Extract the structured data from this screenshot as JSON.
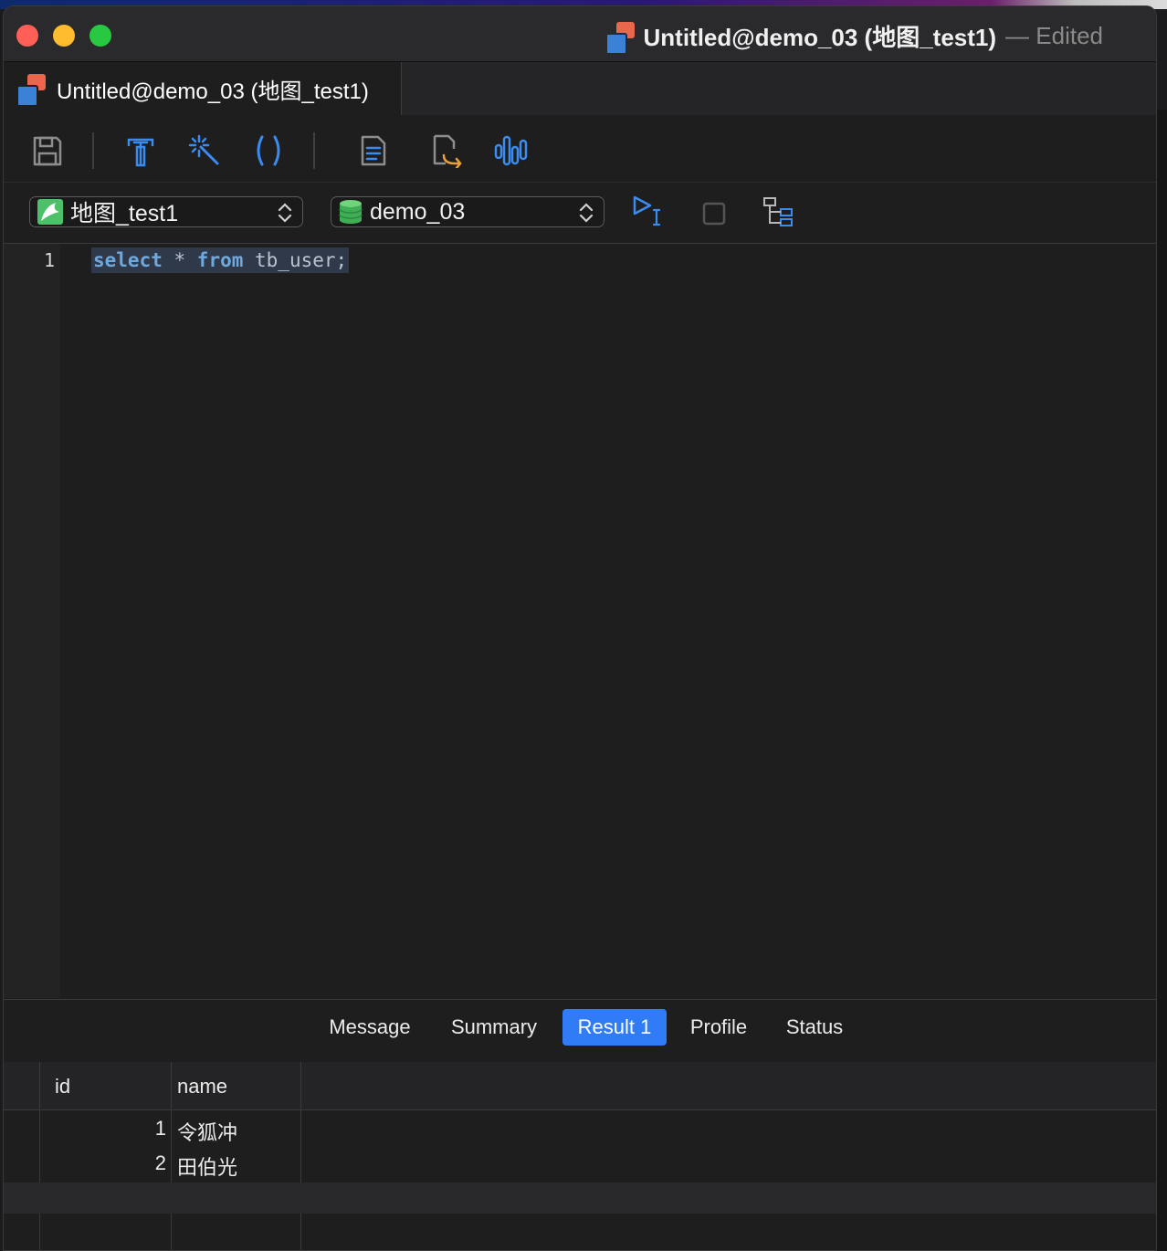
{
  "window": {
    "title": "Untitled@demo_03 (地图_test1)",
    "edited_suffix": "— Edited"
  },
  "tab": {
    "label": "Untitled@demo_03 (地图_test1)"
  },
  "toolbar": {
    "icons": [
      "save-icon",
      "format-sql-icon",
      "beautify-wand-icon",
      "parentheses-icon",
      "code-snippet-icon",
      "export-query-icon",
      "explain-chart-icon"
    ]
  },
  "selectors": {
    "connection": "地图_test1",
    "database": "demo_03"
  },
  "editor": {
    "line_number": "1",
    "code": {
      "kw1": "select",
      "t1": " * ",
      "kw2": "from",
      "t2": " tb_user;"
    }
  },
  "result_tabs": [
    "Message",
    "Summary",
    "Result 1",
    "Profile",
    "Status"
  ],
  "active_result_tab": "Result 1",
  "table": {
    "columns": [
      "id",
      "name"
    ],
    "rows": [
      {
        "id": "1",
        "name": "令狐冲"
      },
      {
        "id": "2",
        "name": "田伯光"
      }
    ]
  },
  "colors": {
    "accent": "#2f7cf6",
    "icon_blue": "#3b8cf0",
    "icon_orange": "#e9a23b"
  }
}
